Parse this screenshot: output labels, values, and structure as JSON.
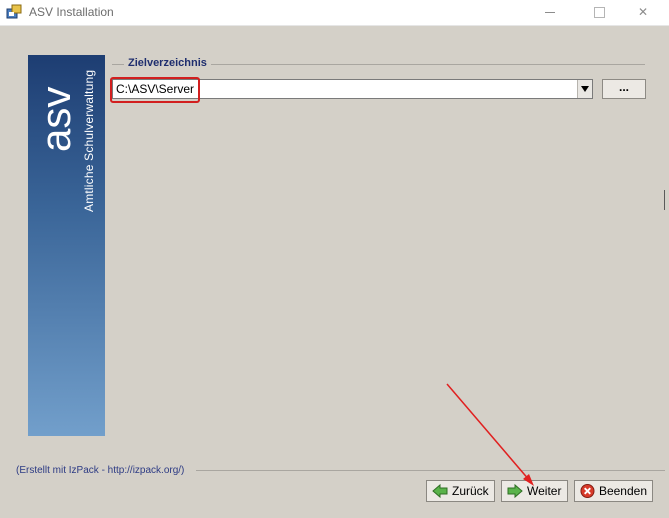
{
  "window": {
    "title": "ASV Installation",
    "controls": {
      "minimize_icon": "minimize-icon",
      "maximize_icon": "maximize-icon",
      "close_symbol": "✕"
    }
  },
  "banner": {
    "logo_text": "asv",
    "vertical_text": "Amtliche Schulverwaltung"
  },
  "section": {
    "title": "Zielverzeichnis"
  },
  "target_path": {
    "value": "C:\\ASV\\Server",
    "browse_label": "..."
  },
  "footer": {
    "credit": "(Erstellt mit IzPack - http://izpack.org/)",
    "back_label": "Zurück",
    "next_label": "Weiter",
    "quit_label": "Beenden"
  },
  "colors": {
    "accent_annotation": "#d21f1f",
    "banner_top": "#1d3d72",
    "banner_bottom": "#729fcb",
    "section_title": "#1f2e6e"
  }
}
